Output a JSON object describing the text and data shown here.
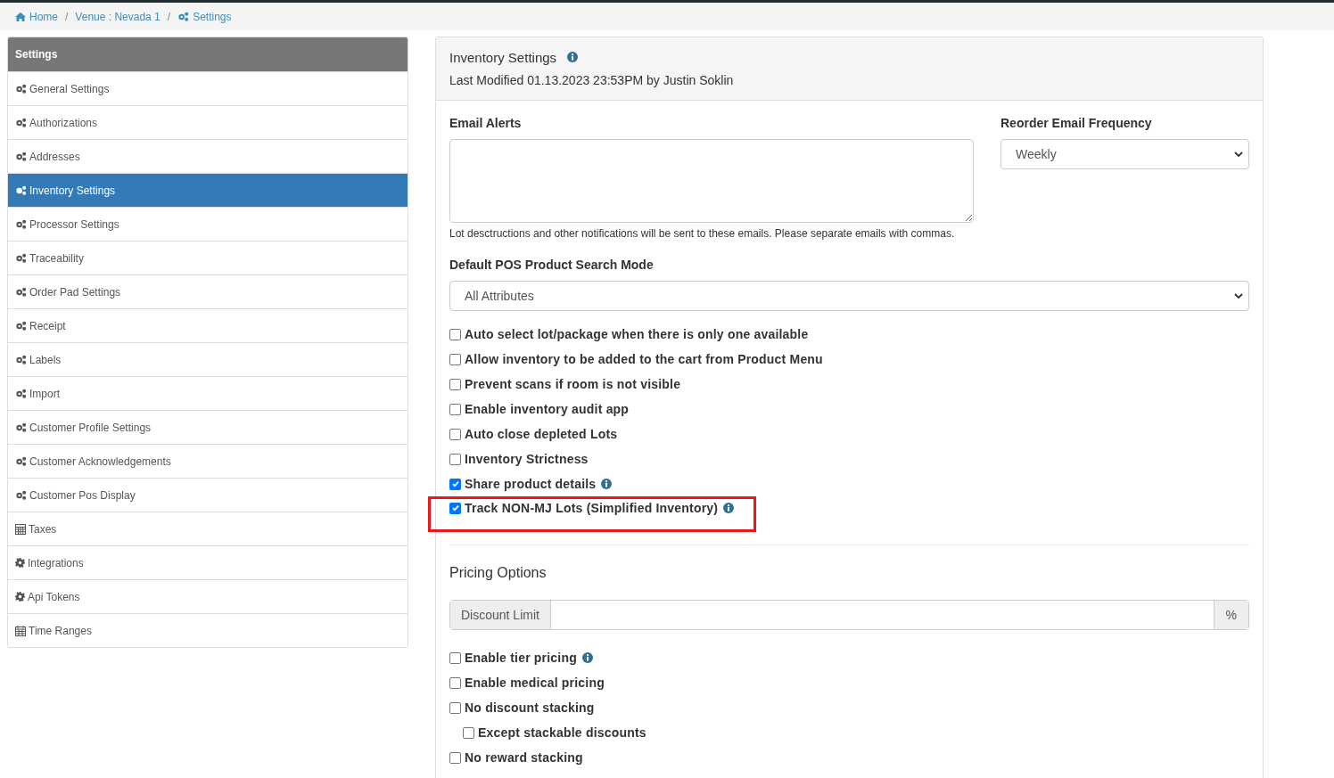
{
  "breadcrumb": [
    {
      "kind": "link",
      "label": "Home"
    },
    {
      "kind": "separator",
      "label": "/"
    },
    {
      "kind": "link",
      "label": "Venue : Nevada 1"
    },
    {
      "kind": "separator",
      "label": "/"
    },
    {
      "kind": "link",
      "label": "Settings"
    }
  ],
  "sidebar": {
    "title": "Settings",
    "items": [
      {
        "label": "General Settings",
        "selected": false
      },
      {
        "label": "Authorizations",
        "selected": false
      },
      {
        "label": "Addresses",
        "selected": false
      },
      {
        "label": "Inventory Settings",
        "selected": true
      },
      {
        "label": "Processor Settings",
        "selected": false
      },
      {
        "label": "Traceability",
        "selected": false
      },
      {
        "label": "Order Pad Settings",
        "selected": false
      },
      {
        "label": "Receipt",
        "selected": false
      },
      {
        "label": "Labels",
        "selected": false
      },
      {
        "label": "Import",
        "selected": false
      },
      {
        "label": "Customer Profile Settings",
        "selected": false
      },
      {
        "label": "Customer Acknowledgements",
        "selected": false
      },
      {
        "label": "Customer Pos Display",
        "selected": false
      },
      {
        "label": "Taxes",
        "selected": false
      },
      {
        "label": "Integrations",
        "selected": false
      },
      {
        "label": "Api Tokens",
        "selected": false
      },
      {
        "label": "Time Ranges",
        "selected": false
      }
    ]
  },
  "panel": {
    "title": "Inventory Settings",
    "subtitle": "Last Modified 01.13.2023 23:53PM by Justin Soklin",
    "email_alerts": {
      "label": "Email Alerts",
      "help": "Lot desctructions and other notifications will be sent to these emails. Please separate emails with commas."
    },
    "reorder_frequency": {
      "label": "Reorder Email Frequency",
      "value": "Weekly"
    },
    "search_mode": {
      "label": "Default POS Product Search Mode",
      "value": "All Attributes"
    },
    "options": [
      {
        "label": "Auto select lot/package when there is only one available",
        "checked": false,
        "info": false,
        "highlighted": false
      },
      {
        "label": "Allow inventory to be added to the cart from Product Menu",
        "checked": false,
        "info": false,
        "highlighted": false
      },
      {
        "label": "Prevent scans if room is not visible",
        "checked": false,
        "info": false,
        "highlighted": false
      },
      {
        "label": "Enable inventory audit app",
        "checked": false,
        "info": false,
        "highlighted": false
      },
      {
        "label": "Auto close depleted Lots",
        "checked": false,
        "info": false,
        "highlighted": false
      },
      {
        "label": "Inventory Strictness",
        "checked": false,
        "info": false,
        "highlighted": false
      },
      {
        "label": "Share product details",
        "checked": true,
        "info": true,
        "highlighted": false
      },
      {
        "label": "Track NON-MJ Lots (Simplified Inventory)",
        "checked": true,
        "info": true,
        "highlighted": true
      }
    ],
    "pricing": {
      "title": "Pricing Options",
      "discount_label": "Discount Limit",
      "discount_unit": "%",
      "options": [
        {
          "label": "Enable tier pricing",
          "checked": false,
          "info": true
        },
        {
          "label": "Enable medical pricing",
          "checked": false,
          "info": false
        },
        {
          "label": "No discount stacking",
          "checked": false,
          "info": false,
          "children": [
            {
              "label": "Except stackable discounts",
              "checked": false,
              "info": false
            }
          ]
        },
        {
          "label": "No reward stacking",
          "checked": false,
          "info": false
        }
      ]
    }
  }
}
